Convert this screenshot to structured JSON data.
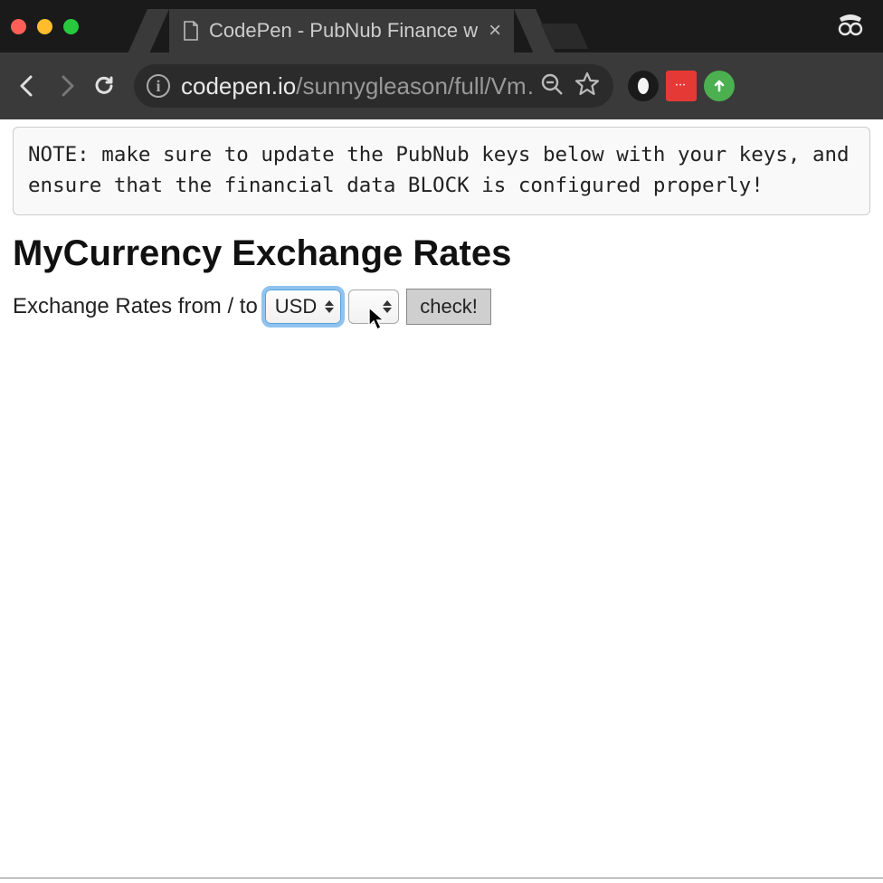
{
  "browser": {
    "tab_title": "CodePen - PubNub Finance w",
    "url_host": "codepen.io",
    "url_path": "/sunnygleason/full/Vm…"
  },
  "page": {
    "note": "NOTE: make sure to update the PubNub keys below with your keys, and ensure that the financial data BLOCK is configured properly!",
    "heading": "MyCurrency Exchange Rates",
    "form": {
      "label": "Exchange Rates from / to",
      "from_value": "USD",
      "to_value": "",
      "button_label": "check!"
    }
  },
  "icons": {
    "close": "×",
    "info": "i"
  }
}
